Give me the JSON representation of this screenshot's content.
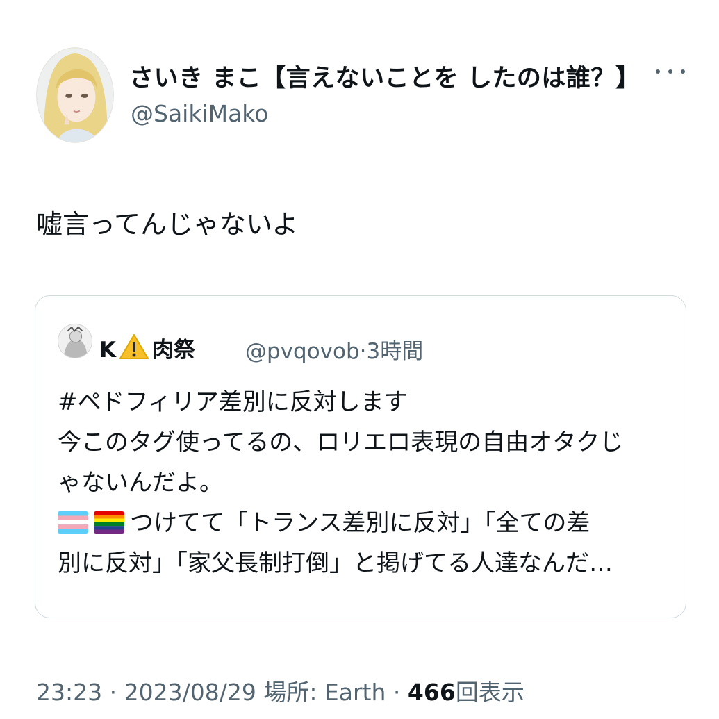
{
  "author": {
    "display_name": "さいき まこ【言えないことを したのは誰？】",
    "handle": "@SaikiMako",
    "avatar_icon": "avatar-illustration-icon",
    "more_icon": "more-options-icon"
  },
  "tweet": {
    "text": "嘘言ってんじゃないよ"
  },
  "quote": {
    "name_prefix": "K",
    "name_emoji": "warning-icon",
    "name_suffix": "肉祭",
    "handle": "@pvqovob",
    "separator": "·",
    "time": "3時間",
    "lines": [
      "#ペドフィリア差別に反対します",
      "今このタグ使ってるの、ロリエロ表現の自由オタクじ",
      "ゃないんだよ。",
      "つけてて「トランス差別に反対」「全ての差",
      "別に反対」「家父長制打倒」と掲げてる人達なんだ…"
    ],
    "line4_flags": [
      "transgender-flag-icon",
      "rainbow-flag-icon"
    ]
  },
  "footer": {
    "time": "23:23",
    "separator": "·",
    "date": "2023/08/29",
    "location_label": "場所: Earth",
    "views_count": "466",
    "views_label": "回表示"
  },
  "colors": {
    "text_primary": "#0f1419",
    "text_secondary": "#536471",
    "border": "#cfd9de"
  }
}
